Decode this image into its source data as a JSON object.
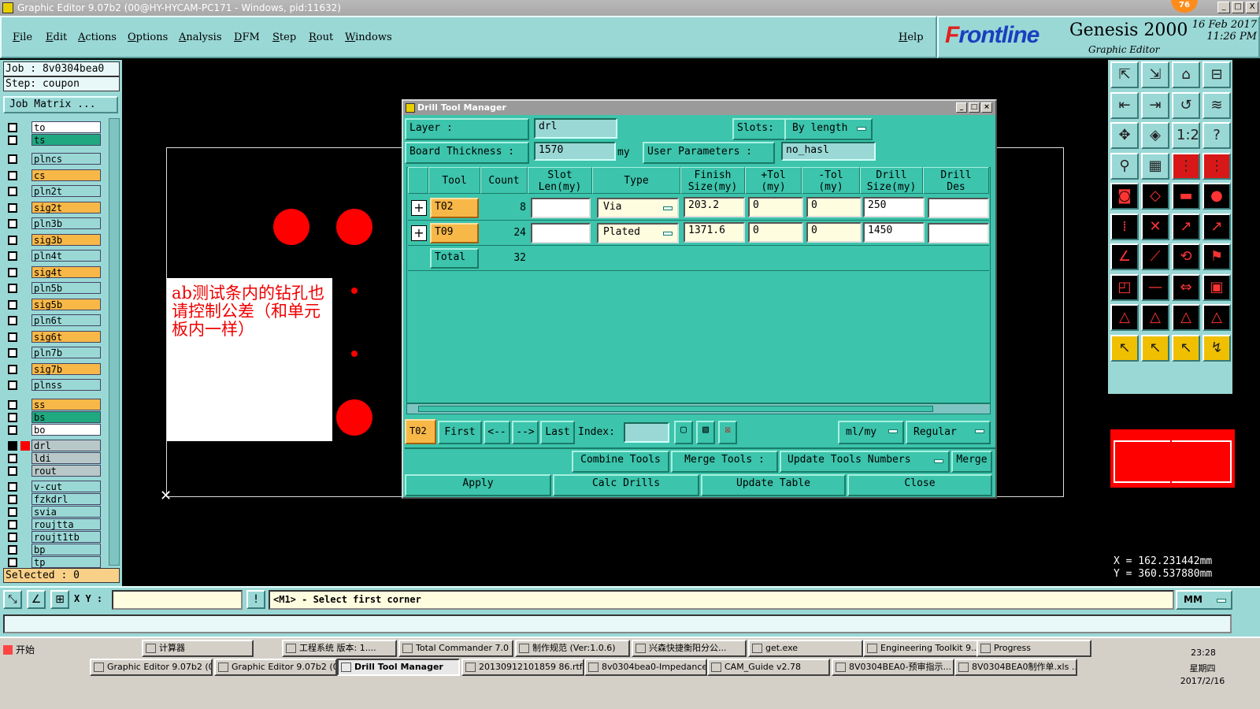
{
  "window": {
    "title": "Graphic Editor 9.07b2 (00@HY-HYCAM-PC171 - Windows, pid:11632)",
    "badge": "76",
    "buttons": [
      "_",
      "□",
      "X"
    ]
  },
  "menu": {
    "items": [
      "File",
      "Edit",
      "Actions",
      "Options",
      "Analysis",
      "DFM",
      "Step",
      "Rout",
      "Windows"
    ],
    "help": "Help"
  },
  "brand": {
    "logo_f": "F",
    "logo_rest": "rontline",
    "product": "Genesis 2000",
    "subtitle": "Graphic Editor",
    "date": "16 Feb 2017",
    "time": "11:26 PM"
  },
  "left": {
    "job": "Job  : 8v0304bea0",
    "step": "Step: coupon",
    "job_matrix": "Job Matrix ...",
    "selected": "Selected : 0",
    "layers": [
      {
        "name": "to",
        "color": "#ffffff"
      },
      {
        "name": "ts",
        "color": "#20a880"
      },
      {
        "name": "plncs",
        "color": "#9ad8d6"
      },
      {
        "name": "cs",
        "color": "#f8b848"
      },
      {
        "name": "pln2t",
        "color": "#9ad8d6"
      },
      {
        "name": "sig2t",
        "color": "#f8b848"
      },
      {
        "name": "pln3b",
        "color": "#9ad8d6"
      },
      {
        "name": "sig3b",
        "color": "#f8b848"
      },
      {
        "name": "pln4t",
        "color": "#9ad8d6"
      },
      {
        "name": "sig4t",
        "color": "#f8b848"
      },
      {
        "name": "pln5b",
        "color": "#9ad8d6"
      },
      {
        "name": "sig5b",
        "color": "#f8b848"
      },
      {
        "name": "pln6t",
        "color": "#9ad8d6"
      },
      {
        "name": "sig6t",
        "color": "#f8b848"
      },
      {
        "name": "pln7b",
        "color": "#9ad8d6"
      },
      {
        "name": "sig7b",
        "color": "#f8b848"
      },
      {
        "name": "plnss",
        "color": "#9ad8d6"
      },
      {
        "name": "ss",
        "color": "#f8b848"
      },
      {
        "name": "bs",
        "color": "#20a880"
      },
      {
        "name": "bo",
        "color": "#ffffff"
      },
      {
        "name": "drl",
        "color": "#b8c8c8"
      },
      {
        "name": "ldi",
        "color": "#b8c8c8"
      },
      {
        "name": "rout",
        "color": "#b8c8c8"
      },
      {
        "name": "v-cut",
        "color": "#9ad8d6"
      },
      {
        "name": "fzkdrl",
        "color": "#9ad8d6"
      },
      {
        "name": "svia",
        "color": "#9ad8d6"
      },
      {
        "name": "roujtta",
        "color": "#9ad8d6"
      },
      {
        "name": "roujt1tb",
        "color": "#9ad8d6"
      },
      {
        "name": "bp",
        "color": "#9ad8d6"
      },
      {
        "name": "tp",
        "color": "#9ad8d6"
      }
    ]
  },
  "canvas": {
    "note": "ab测试条内的钻孔也请控制公差（和单元板内一样）"
  },
  "coords": {
    "x": "X  =  162.231442mm",
    "y": "Y  =  360.537880mm"
  },
  "status": {
    "xy_label": "X Y :",
    "prompt": "<M1> - Select first corner",
    "units": "MM"
  },
  "dialog": {
    "title": "Drill Tool Manager",
    "layer_label": "Layer             :",
    "layer_value": "drl",
    "slots_label": "Slots:",
    "slots_value": "By length",
    "thickness_label": "Board Thickness  :",
    "thickness_value": "1570",
    "thickness_unit": "my",
    "user_params_label": "User Parameters  :",
    "user_params_value": "no_hasl",
    "headers": {
      "tool": "Tool",
      "count": "Count",
      "slot_len": "Slot\nLen(my)",
      "type": "Type",
      "finish": "Finish\nSize(my)",
      "ptol": "+Tol\n(my)",
      "mtol": "-Tol\n(my)",
      "drill_size": "Drill\nSize(my)",
      "drill_des": "Drill\nDes"
    },
    "rows": [
      {
        "tool": "T02",
        "count": "8",
        "slot_len": "",
        "type": "Via",
        "finish": "203.2",
        "ptol": "0",
        "mtol": "0",
        "drill": "250",
        "des": ""
      },
      {
        "tool": "T09",
        "count": "24",
        "slot_len": "",
        "type": "Plated",
        "finish": "1371.6",
        "ptol": "0",
        "mtol": "0",
        "drill": "1450",
        "des": ""
      }
    ],
    "total_label": "Total",
    "total_count": "32",
    "nav": {
      "current": "T02",
      "first": "First",
      "prev": "<--",
      "next": "-->",
      "last": "Last",
      "index_label": "Index:",
      "units": "ml/my",
      "mode": "Regular"
    },
    "actions": {
      "combine": "Combine Tools",
      "merge_tools": "Merge Tools :",
      "update_numbers": "Update Tools Numbers",
      "merge": "Merge",
      "apply": "Apply",
      "calc": "Calc Drills",
      "update_table": "Update Table",
      "close": "Close"
    }
  },
  "taskbar": {
    "start": "开始",
    "row1": [
      "计算器",
      "工程系统  版本: 1....",
      "Total Commander 7.0 ...",
      "制作规范 (Ver:1.0.6)",
      "兴森快捷衡阳分公...",
      "get.exe",
      "Engineering Toolkit 9....",
      "Progress"
    ],
    "row2": [
      "Graphic Editor 9.07b2 (0...",
      "Graphic Editor 9.07b2 (0...",
      "Drill Tool Manager",
      "20130912101859 86.rtf [...",
      "8v0304bea0-Impedance ...",
      "CAM_Guide v2.78",
      "8V0304BEA0-预审指示...",
      "8V0304BEA0制作单.xls ..."
    ],
    "clock_time": "23:28",
    "clock_day": "星期四",
    "clock_date": "2017/2/16"
  }
}
